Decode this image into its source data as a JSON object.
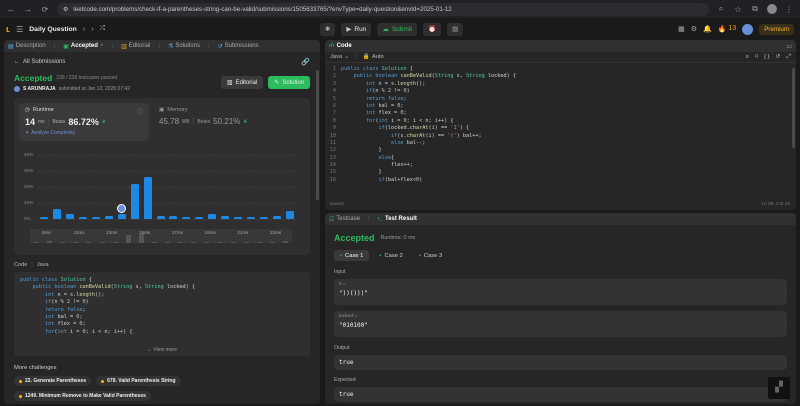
{
  "browser": {
    "url": "leetcode.com/problems/check-if-a-parentheses-string-can-be-valid/submissions/1505633765/?envType=daily-question&envId=2025-01-12"
  },
  "topbar": {
    "daily": "Daily Question",
    "run": "Run",
    "submit": "Submit",
    "streak": "13",
    "premium": "Premium"
  },
  "left_tabs": [
    {
      "label": "Description"
    },
    {
      "label": "Accepted"
    },
    {
      "label": "Editorial"
    },
    {
      "label": "Solutions"
    },
    {
      "label": "Submissions"
    }
  ],
  "submission": {
    "back": "All Submissions",
    "status": "Accepted",
    "passed": "238 / 238 testcases passed",
    "user": "S ARUNRAJA",
    "submitted": "submitted at Jan 12, 2025 07:42",
    "editorial_btn": "Editorial",
    "solution_btn": "Solution",
    "runtime_label": "Runtime",
    "runtime_value": "14",
    "runtime_unit": "ms",
    "runtime_beats": "Beats",
    "runtime_pct": "86.72%",
    "analyze": "Analyze Complexity",
    "memory_label": "Memory",
    "memory_value": "45.78",
    "memory_unit": "MB",
    "memory_beats": "Beats",
    "memory_pct": "50.21%"
  },
  "chart_data": {
    "type": "bar",
    "ylabels": [
      "40%",
      "30%",
      "20%",
      "10%",
      "0%"
    ],
    "ylim": [
      0,
      40
    ],
    "values": [
      1.5,
      6.5,
      3,
      1,
      1,
      2,
      3,
      22,
      26,
      2,
      2,
      1,
      1,
      3,
      2,
      1,
      1,
      1,
      2,
      5
    ],
    "highlight_index": 6,
    "xlabels": [
      "8ms",
      "11ms",
      "13ms",
      "15ms",
      "17ms",
      "19ms",
      "21ms",
      "23ms"
    ]
  },
  "code_section": {
    "label": "Code",
    "lang": "Java",
    "view_more": "View more",
    "lines": [
      "public class Solution {",
      "    public boolean canBeValid(String s, String locked) {",
      "        int n = s.length();",
      "        if(n % 2 != 0)",
      "        return false;",
      "        int bal = 0;",
      "        int flex = 0;",
      "        for(int i = 0; i < n; i++) {"
    ]
  },
  "more": {
    "title": "More challenges",
    "items": [
      "22. Generate Parentheses",
      "678. Valid Parenthesis String",
      "1249. Minimum Remove to Make Valid Parentheses"
    ]
  },
  "editor": {
    "tab": "Code",
    "lang": "Java",
    "auto": "Auto",
    "saved": "Saved",
    "cursor": "Ln 58, Col 16",
    "lines": [
      "public class Solution {",
      "    public boolean canBeValid(String s, String locked) {",
      "        int n = s.length();",
      "        if(n % 2 != 0)",
      "        return false;",
      "        int bal = 0;",
      "        int flex = 0;",
      "        for(int i = 0; i < n; i++) {",
      "            if(locked.charAt(i) == '1') {",
      "                if(s.charAt(i) == '(') bal++;",
      "                else bal--;",
      "            }",
      "            else{",
      "                flex++;",
      "            }",
      "            if(bal+flex<0)"
    ],
    "line_numbers": [
      "1",
      "2",
      "3",
      "4",
      "5",
      "6",
      "7",
      "8",
      "9",
      "10",
      "11",
      "12",
      "13",
      "14",
      "15",
      "16"
    ]
  },
  "result": {
    "tab_testcase": "Testcase",
    "tab_result": "Test Result",
    "status": "Accepted",
    "runtime": "Runtime: 0 ms",
    "cases": [
      "Case 1",
      "Case 2",
      "Case 3"
    ],
    "input_label": "Input",
    "param1_name": "s =",
    "param1_value": "\"))()))\"",
    "param2_name": "locked =",
    "param2_value": "\"010100\"",
    "output_label": "Output",
    "output_value": "true",
    "expected_label": "Expected",
    "expected_value": "true"
  }
}
